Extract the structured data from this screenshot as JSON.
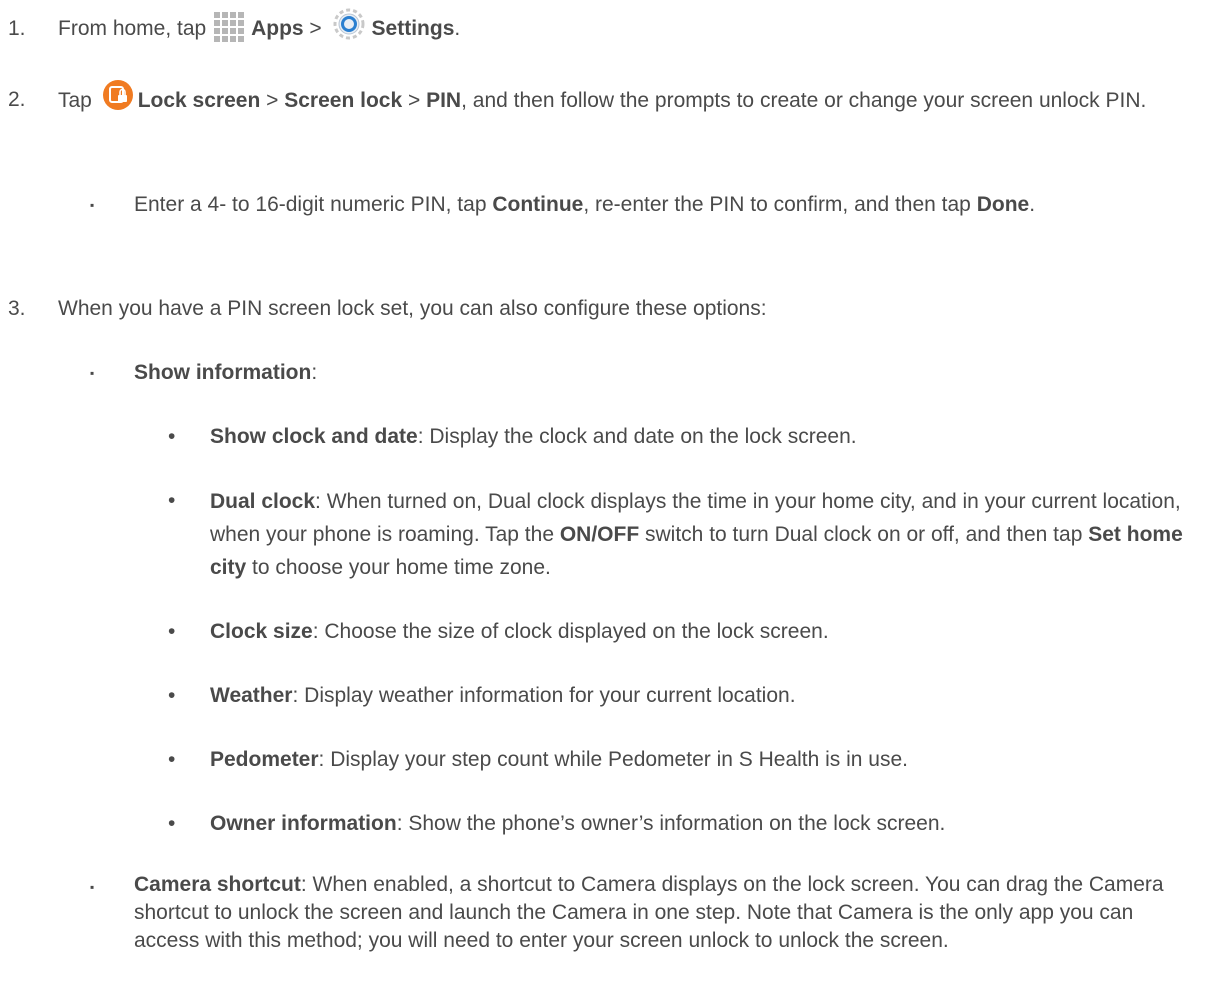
{
  "steps": [
    {
      "number": "1.",
      "parts": [
        "From home, tap",
        "Apps",
        ">",
        "Settings",
        "."
      ]
    },
    {
      "number": "2.",
      "parts": [
        "Tap",
        "Lock screen",
        ">",
        "Screen lock",
        ">",
        "PIN",
        ", and then follow the prompts to create or change your screen unlock PIN."
      ],
      "bullet": {
        "parts": [
          "Enter a 4- to 16-digit numeric PIN, tap",
          "Continue",
          ", re-enter the PIN to confirm, and then tap",
          "Done",
          "."
        ]
      }
    },
    {
      "number": "3.",
      "parts": [
        "When you have a PIN screen lock set, you can also configure these options:"
      ],
      "show_info": {
        "label": "Show information",
        "suffix": ":",
        "items": [
          {
            "label": "Show clock and date",
            "text": ": Display the clock and date on the lock screen."
          },
          {
            "label": "Dual clock",
            "text": ": When turned on, Dual clock displays the time in your home city, and in your current location, when your phone is roaming. Tap the",
            "label2": "ON/OFF",
            "text2": "switch to turn Dual clock on or off, and then tap",
            "label3": "Set home city",
            "text3": "to choose your home time zone."
          },
          {
            "label": "Clock size",
            "text": ": Choose the size of clock displayed on the lock screen."
          },
          {
            "label": "Weather",
            "text": ": Display weather information for your current location."
          },
          {
            "label": "Pedometer",
            "text": ": Display your step count while Pedometer in S Health is in use."
          },
          {
            "label": "Owner information",
            "text": ": Show the phone’s owner’s information on the lock screen."
          }
        ]
      },
      "camera": {
        "label": "Camera shortcut",
        "text": ": When enabled, a shortcut to Camera displays on the lock screen. You can drag the Camera shortcut to unlock the screen and launch the Camera in one step. Note that Camera is the only app you can access with this method; you will need to enter your screen unlock to unlock the screen."
      }
    }
  ],
  "bullets": {
    "square": "▪",
    "dot": "•"
  },
  "icons": {
    "apps": "apps-grid-icon",
    "settings": "settings-gear-icon",
    "lock": "lock-screen-icon"
  },
  "colors": {
    "text": "#4a4a4a",
    "lock_icon": "#f07b22",
    "settings_blue": "#2a7fd0"
  }
}
